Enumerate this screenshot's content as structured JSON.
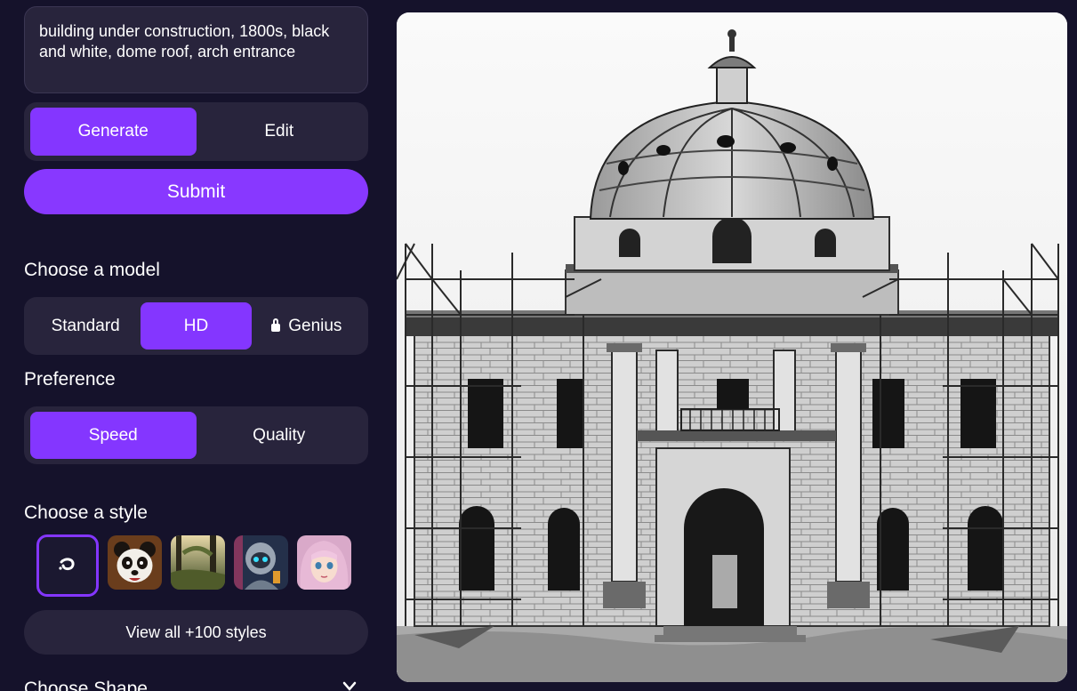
{
  "prompt": {
    "text": "building under construction, 1800s, black and white, dome roof, arch entrance"
  },
  "mode": {
    "generate": "Generate",
    "edit": "Edit"
  },
  "submit": "Submit",
  "model": {
    "title": "Choose a model",
    "options": [
      "Standard",
      "HD",
      "Genius"
    ],
    "selected": "HD"
  },
  "preference": {
    "title": "Preference",
    "options": [
      "Speed",
      "Quality"
    ],
    "selected": "Speed"
  },
  "style": {
    "title": "Choose a style",
    "thumbs": [
      "no-style-icon",
      "panda",
      "forest",
      "robot",
      "anime-girl"
    ],
    "view_all": "View all +100 styles"
  },
  "shape": {
    "title": "Choose Shape"
  },
  "colors": {
    "accent": "#8436ff",
    "background": "#15122b",
    "card": "#28243c"
  }
}
